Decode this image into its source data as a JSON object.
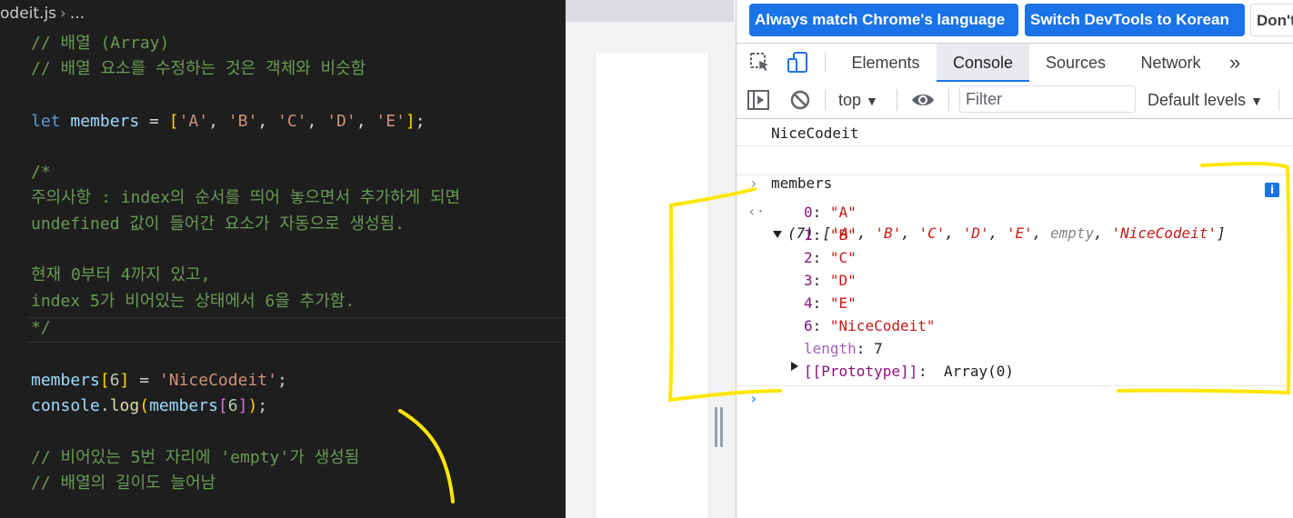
{
  "editor": {
    "breadcrumb": {
      "file": "odeit.js",
      "more": "..."
    },
    "lines": {
      "c1": "// 배열 (Array)",
      "c2": "// 배열 요소를 수정하는 것은 객체와 비슷함",
      "let_kw": "let",
      "members": "members",
      "eq": " = ",
      "open": "[",
      "a": "'A'",
      "b": "'B'",
      "c": "'C'",
      "d": "'D'",
      "e": "'E'",
      "comma": ", ",
      "close": "]",
      "semi": ";",
      "block_open": "/*",
      "block1": "주의사항 : index의 순서를 띄어 놓으면서 추가하게 되면",
      "block2": "undefined 값이 들어간 요소가 자동으로 생성됨.",
      "block3": "현재 0부터 4까지 있고,",
      "block4": "index 5가 비어있는 상태에서 6을 추가함.",
      "block_close": "*/",
      "idx6": "6",
      "nice": "'NiceCodeit'",
      "console": "console",
      "dot": ".",
      "log": "log",
      "paren_open": "(",
      "paren_close": ")",
      "c3": "// 비어있는 5번 자리에 'empty'가 생성됨",
      "c4": "// 배열의 길이도 늘어남"
    }
  },
  "devtools": {
    "infobar": {
      "match_language": "Always match Chrome's language",
      "switch_language": "Switch DevTools to Korean",
      "dont_show": "Don't"
    },
    "tabs": [
      "Elements",
      "Console",
      "Sources",
      "Network"
    ],
    "active_tab": "Console",
    "more_tabs": "»",
    "toolbar": {
      "context": "top",
      "filter_placeholder": "Filter",
      "levels": "Default levels"
    },
    "console": {
      "log_output": "NiceCodeit",
      "input": "members",
      "array_summary": {
        "length_prefix": "(7)",
        "open": " [",
        "items": [
          "'A'",
          "'B'",
          "'C'",
          "'D'",
          "'E'",
          "empty",
          "'NiceCodeit'"
        ],
        "close": "]"
      },
      "entries": [
        {
          "key": "0",
          "value": "\"A\""
        },
        {
          "key": "1",
          "value": "\"B\""
        },
        {
          "key": "2",
          "value": "\"C\""
        },
        {
          "key": "3",
          "value": "\"D\""
        },
        {
          "key": "4",
          "value": "\"E\""
        },
        {
          "key": "6",
          "value": "\"NiceCodeit\""
        }
      ],
      "length_key": "length",
      "length_value": "7",
      "prototype_key": "[[Prototype]]",
      "prototype_value": "Array(0)",
      "info_badge": "i"
    }
  },
  "colors": {
    "accent": "#1a73e8",
    "annotation": "#ffe600",
    "editor_bg": "#1e1e1e"
  }
}
